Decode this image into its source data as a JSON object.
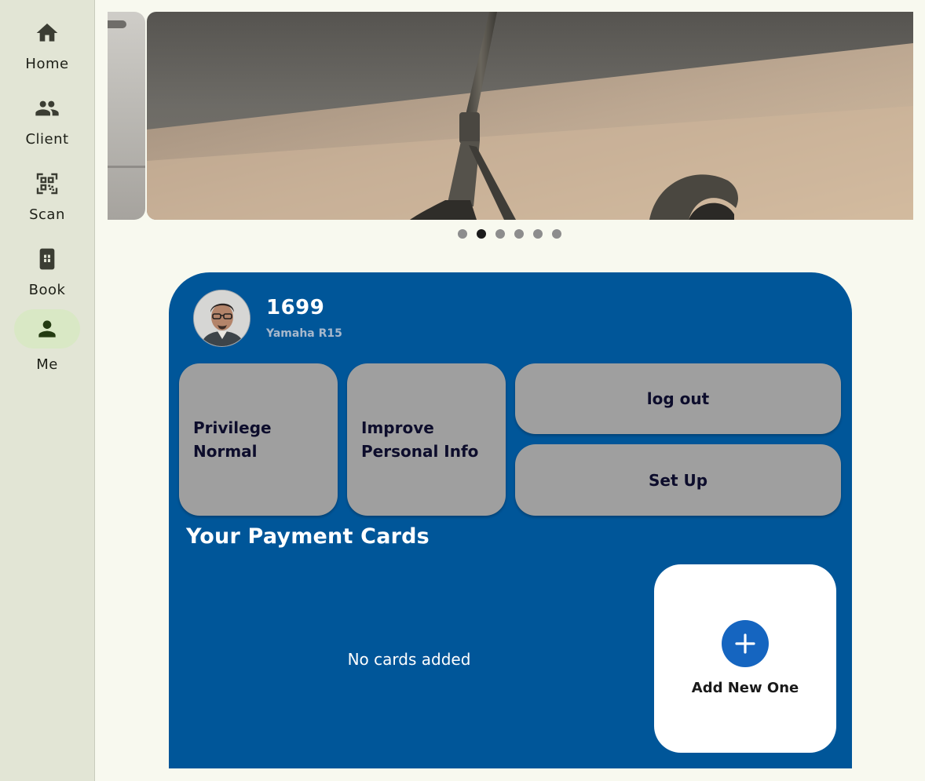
{
  "nav": {
    "items": [
      {
        "label": "Home",
        "icon": "home-icon"
      },
      {
        "label": "Client",
        "icon": "people-icon"
      },
      {
        "label": "Scan",
        "icon": "qr-scan-icon"
      },
      {
        "label": "Book",
        "icon": "book-icon"
      },
      {
        "label": "Me",
        "icon": "person-icon"
      }
    ],
    "active": "Me"
  },
  "carousel": {
    "slide_count": 6,
    "active_slide": 2
  },
  "profile": {
    "name": "1699",
    "vehicle": "Yamaha R15"
  },
  "tiles": {
    "privilege_label": "Privilege",
    "privilege_value": "Normal",
    "improve_line1": "Improve",
    "improve_line2": "Personal Info",
    "logout_label": "log out",
    "setup_label": "Set Up"
  },
  "payment": {
    "title": "Your Payment Cards",
    "empty_message": "No cards added",
    "add_label": "Add New One"
  },
  "colors": {
    "background": "#f8f9ef",
    "rail": "#e2e5d5",
    "active_indicator": "#d9e8c5",
    "panel": "#005699",
    "tile": "#9f9f9f",
    "add_button": "#1565c0"
  }
}
